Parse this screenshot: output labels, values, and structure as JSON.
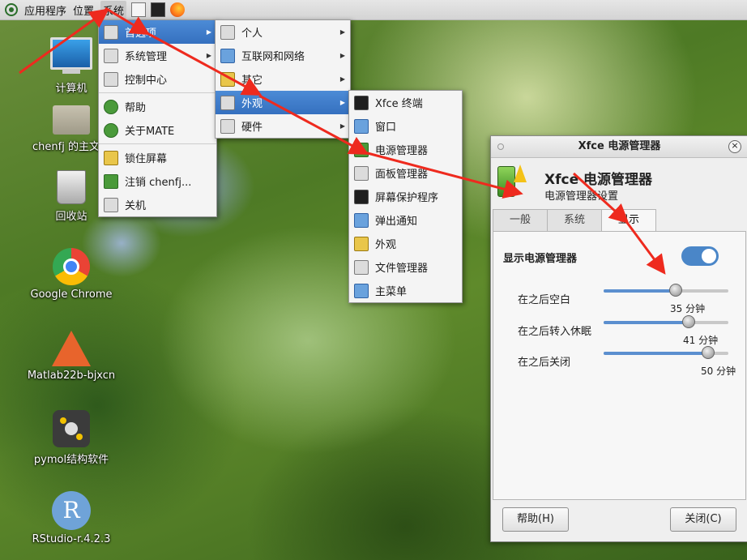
{
  "topbar": {
    "menus": [
      "应用程序",
      "位置",
      "系统"
    ],
    "icons": [
      "mate-logo-icon",
      "text-editor-icon",
      "terminal-icon",
      "firefox-icon"
    ]
  },
  "desktop": {
    "items": [
      {
        "label": "计算机",
        "icon": "computer-icon"
      },
      {
        "label": "chenfj 的主文件",
        "icon": "home-folder-icon"
      },
      {
        "label": "回收站",
        "icon": "trash-icon"
      },
      {
        "label": "Google Chrome",
        "icon": "chrome-icon"
      },
      {
        "label": "Matlab22b-bjxcn",
        "icon": "matlab-icon"
      },
      {
        "label": "pymol结构软件",
        "icon": "pymol-icon"
      },
      {
        "label": "RStudio-r.4.2.3",
        "icon": "rstudio-icon"
      }
    ],
    "r_glyph": "R"
  },
  "system_menu": {
    "items": [
      {
        "label": "首选项",
        "has_sub": true
      },
      {
        "label": "系统管理",
        "has_sub": true
      },
      {
        "label": "控制中心",
        "has_sub": false
      },
      {
        "label": "帮助",
        "has_sub": false
      },
      {
        "label": "关于MATE",
        "has_sub": false
      },
      {
        "label": "锁住屏幕",
        "has_sub": false
      },
      {
        "label": "注销 chenfj...",
        "has_sub": false
      },
      {
        "label": "关机",
        "has_sub": false
      }
    ]
  },
  "prefs_menu": {
    "items": [
      {
        "label": "个人"
      },
      {
        "label": "互联网和网络"
      },
      {
        "label": "其它"
      },
      {
        "label": "外观"
      },
      {
        "label": "硬件"
      }
    ]
  },
  "appearance_menu": {
    "items": [
      {
        "label": "Xfce 终端"
      },
      {
        "label": "窗口"
      },
      {
        "label": "电源管理器"
      },
      {
        "label": "面板管理器"
      },
      {
        "label": "屏幕保护程序"
      },
      {
        "label": "弹出通知"
      },
      {
        "label": "外观"
      },
      {
        "label": "文件管理器"
      },
      {
        "label": "主菜单"
      }
    ]
  },
  "dialog": {
    "title": "Xfce 电源管理器",
    "heading": "Xfce 电源管理器",
    "subheading": "电源管理器设置",
    "tabs": [
      "一般",
      "系统",
      "显示"
    ],
    "active_tab": "显示",
    "section_title": "显示电源管理器",
    "toggle_on": true,
    "sliders": [
      {
        "label": "在之后空白",
        "value_text": "35 分钟",
        "fraction": 0.58
      },
      {
        "label": "在之后转入休眠",
        "value_text": "41 分钟",
        "fraction": 0.68
      },
      {
        "label": "在之后关闭",
        "value_text": "50 分钟",
        "fraction": 0.84
      }
    ],
    "help_button": "帮助(H)",
    "close_button": "关闭(C)"
  },
  "colors": {
    "menu_highlight": "#3f7ccb",
    "toggle_on": "#4a86c8",
    "annotation_arrow": "#ee2a1e"
  }
}
